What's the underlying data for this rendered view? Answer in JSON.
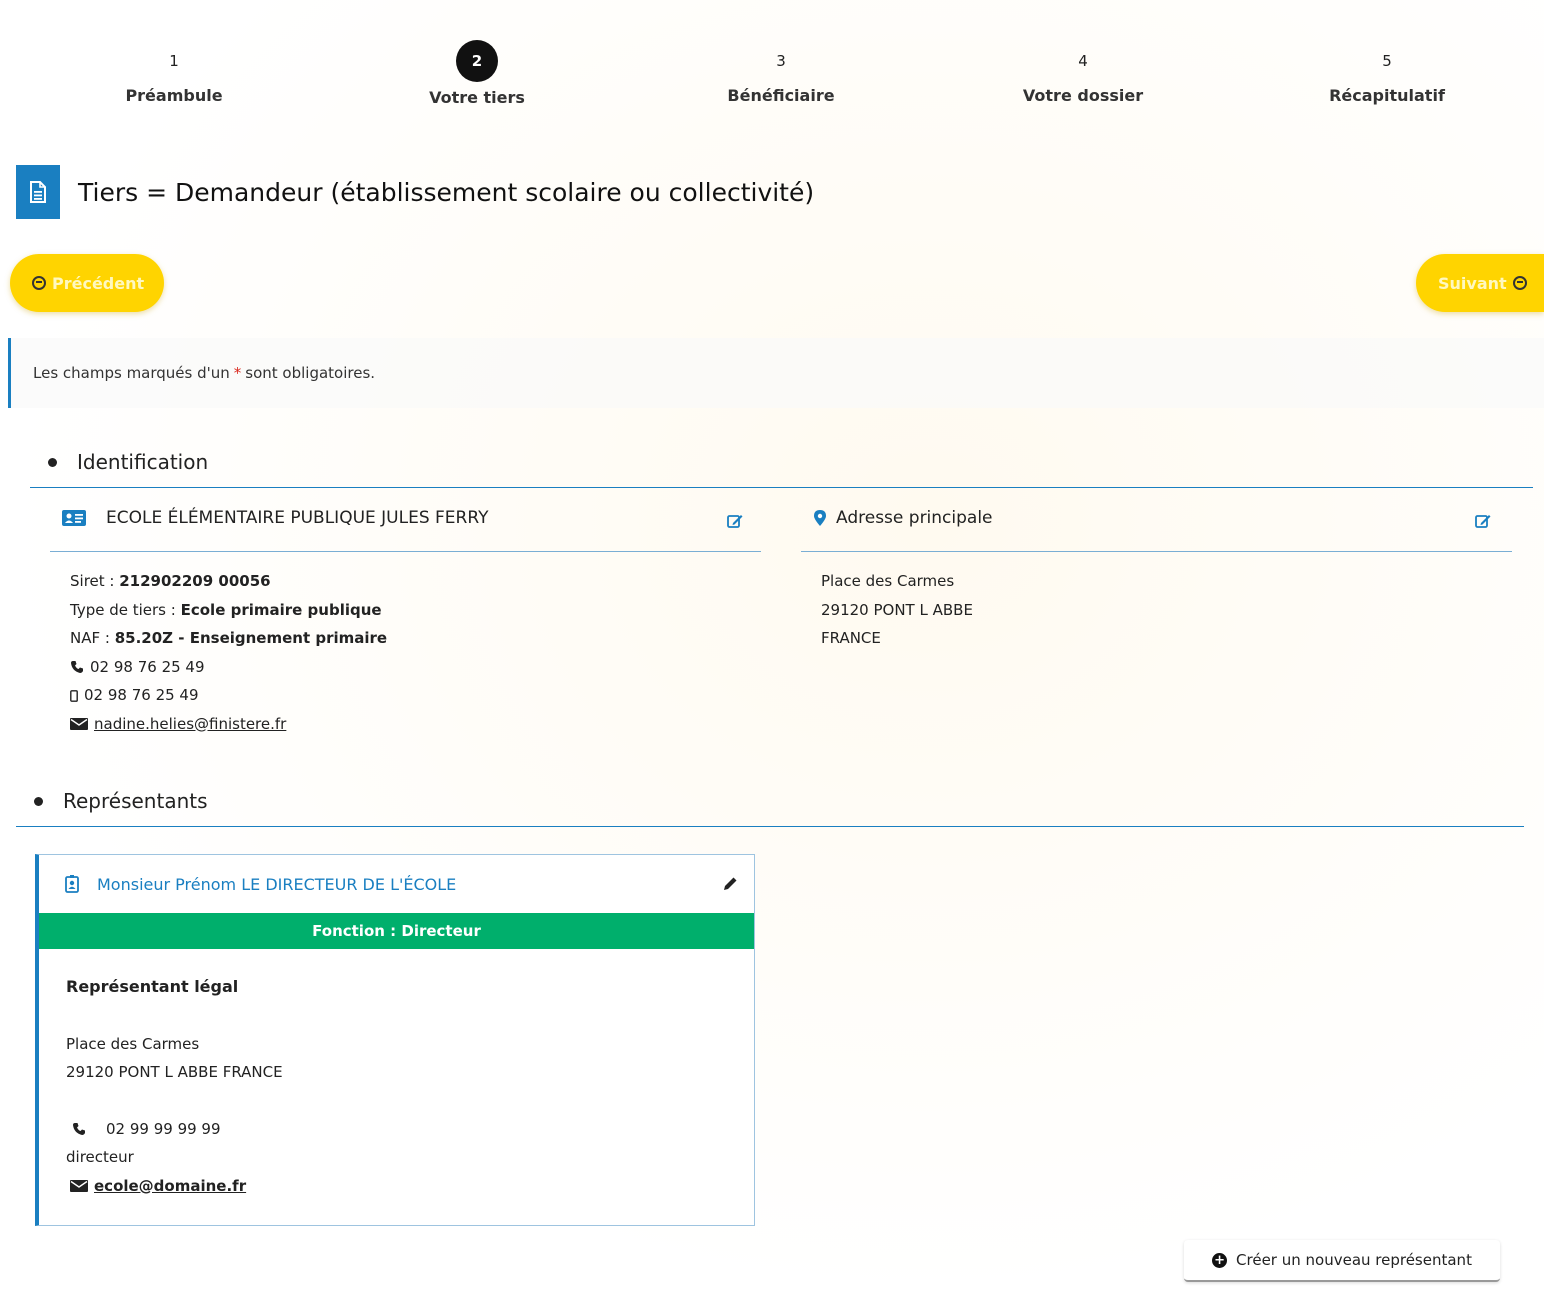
{
  "stepper": {
    "steps": [
      {
        "number": "1",
        "label": "Préambule"
      },
      {
        "number": "2",
        "label": "Votre tiers"
      },
      {
        "number": "3",
        "label": "Bénéficiaire"
      },
      {
        "number": "4",
        "label": "Votre dossier"
      },
      {
        "number": "5",
        "label": "Récapitulatif"
      }
    ]
  },
  "page": {
    "title": "Tiers = Demandeur (établissement scolaire ou collectivité)"
  },
  "nav": {
    "prev_label": "Précédent",
    "next_label": "Suivant"
  },
  "info": {
    "text_before": "Les champs marqués d'un",
    "star": "*",
    "text_after": "sont obligatoires."
  },
  "identification": {
    "heading": "Identification",
    "tiers_name": "ECOLE ÉLÉMENTAIRE PUBLIQUE JULES FERRY",
    "siret_label": "Siret :",
    "siret_value": "212902209 00056",
    "type_label": "Type de tiers :",
    "type_value": "Ecole primaire publique",
    "naf_label": "NAF :",
    "naf_value": "85.20Z - Enseignement primaire",
    "phone": "02 98 76 25 49",
    "mobile": "02 98 76 25 49",
    "email": "nadine.helies@finistere.fr",
    "address_heading": "Adresse principale",
    "address_line1": "Place des Carmes",
    "address_line2": "29120 PONT L ABBE",
    "address_line3": "FRANCE"
  },
  "representants": {
    "heading": "Représentants",
    "items": [
      {
        "name": "Monsieur Prénom LE DIRECTEUR DE L'ÉCOLE",
        "function": "Fonction : Directeur",
        "role": "Représentant légal",
        "address_line1": "Place des Carmes",
        "address_line2": "29120 PONT L ABBE FRANCE",
        "phone": "02 99 99 99 99",
        "title": "directeur",
        "email": "ecole@domaine.fr"
      }
    ],
    "create_label": "Créer un nouveau représentant"
  },
  "colors": {
    "accent_blue": "#1a7fc1",
    "button_yellow": "#ffd400",
    "function_green": "#00af6c",
    "required_red": "#d9261c"
  },
  "icons": {
    "page_title": "document-icon",
    "tiers": "id-card-icon",
    "address": "map-marker-icon",
    "edit": "edit-icon",
    "phone": "phone-icon",
    "mobile": "mobile-icon",
    "email": "envelope-icon",
    "representative": "badge-icon",
    "pencil": "pencil-icon",
    "create": "plus-circle-icon"
  }
}
